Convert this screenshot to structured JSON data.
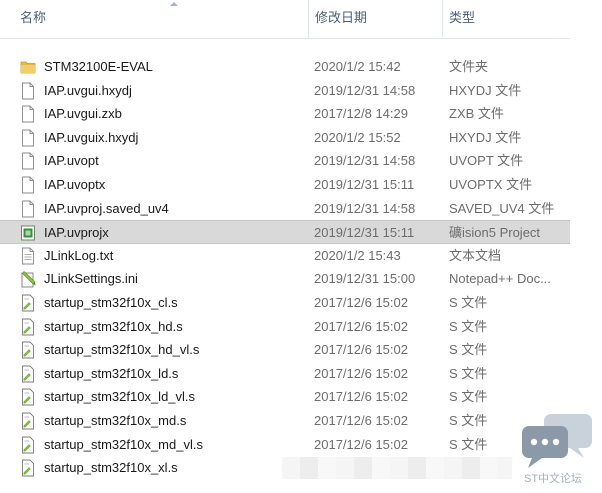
{
  "columns": {
    "name": "名称",
    "date": "修改日期",
    "type": "类型"
  },
  "files": [
    {
      "name": "STM32100E-EVAL",
      "date": "2020/1/2 15:42",
      "type": "文件夹",
      "icon": "folder-icon"
    },
    {
      "name": "IAP.uvgui.hxydj",
      "date": "2019/12/31 14:58",
      "type": "HXYDJ 文件",
      "icon": "file-icon"
    },
    {
      "name": "IAP.uvgui.zxb",
      "date": "2017/12/8 14:29",
      "type": "ZXB 文件",
      "icon": "file-icon"
    },
    {
      "name": "IAP.uvguix.hxydj",
      "date": "2020/1/2 15:52",
      "type": "HXYDJ 文件",
      "icon": "file-icon"
    },
    {
      "name": "IAP.uvopt",
      "date": "2019/12/31 14:58",
      "type": "UVOPT 文件",
      "icon": "file-icon"
    },
    {
      "name": "IAP.uvoptx",
      "date": "2019/12/31 15:11",
      "type": "UVOPTX 文件",
      "icon": "file-icon"
    },
    {
      "name": "IAP.uvproj.saved_uv4",
      "date": "2019/12/31 14:58",
      "type": "SAVED_UV4 文件",
      "icon": "file-icon"
    },
    {
      "name": "IAP.uvprojx",
      "date": "2019/12/31 15:11",
      "type": "礦ision5 Project",
      "icon": "keil-project-icon",
      "selected": true
    },
    {
      "name": "JLinkLog.txt",
      "date": "2020/1/2 15:43",
      "type": "文本文档",
      "icon": "text-file-icon"
    },
    {
      "name": "JLinkSettings.ini",
      "date": "2019/12/31 15:00",
      "type": "Notepad++ Doc...",
      "icon": "notepad-plus-icon"
    },
    {
      "name": "startup_stm32f10x_cl.s",
      "date": "2017/12/6 15:02",
      "type": "S 文件",
      "icon": "source-file-icon"
    },
    {
      "name": "startup_stm32f10x_hd.s",
      "date": "2017/12/6 15:02",
      "type": "S 文件",
      "icon": "source-file-icon"
    },
    {
      "name": "startup_stm32f10x_hd_vl.s",
      "date": "2017/12/6 15:02",
      "type": "S 文件",
      "icon": "source-file-icon"
    },
    {
      "name": "startup_stm32f10x_ld.s",
      "date": "2017/12/6 15:02",
      "type": "S 文件",
      "icon": "source-file-icon"
    },
    {
      "name": "startup_stm32f10x_ld_vl.s",
      "date": "2017/12/6 15:02",
      "type": "S 文件",
      "icon": "source-file-icon"
    },
    {
      "name": "startup_stm32f10x_md.s",
      "date": "2017/12/6 15:02",
      "type": "S 文件",
      "icon": "source-file-icon"
    },
    {
      "name": "startup_stm32f10x_md_vl.s",
      "date": "2017/12/6 15:02",
      "type": "S 文件",
      "icon": "source-file-icon"
    },
    {
      "name": "startup_stm32f10x_xl.s",
      "date": "",
      "type": "",
      "icon": "source-file-icon"
    }
  ],
  "watermark": {
    "text": "ST中文论坛"
  },
  "colors": {
    "header_text": "#4c607a",
    "selection": "#d9d9d9",
    "folder": "#e8b84a"
  }
}
